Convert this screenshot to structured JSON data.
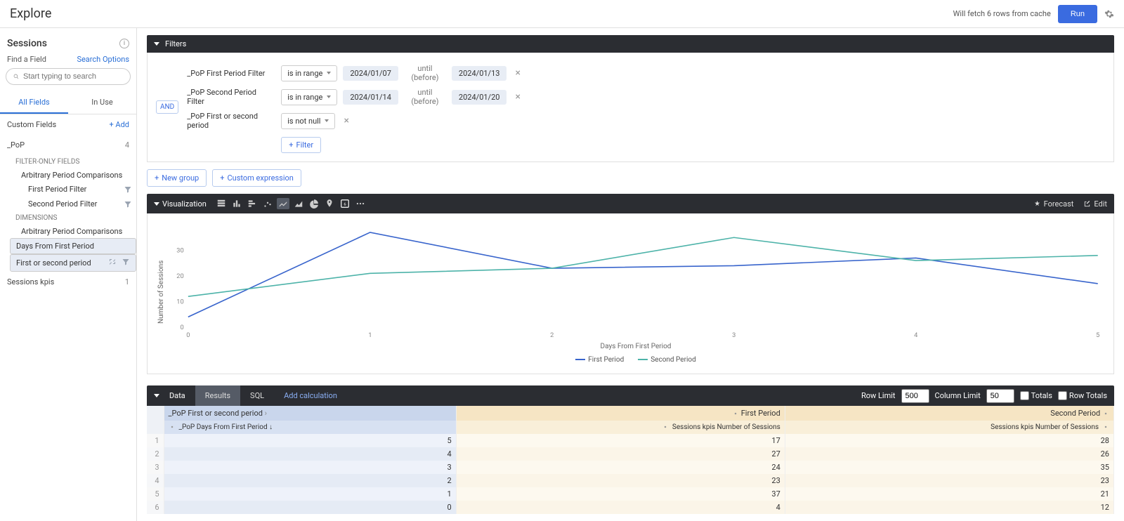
{
  "header": {
    "title": "Explore",
    "fetch_text": "Will fetch 6 rows from cache",
    "run_label": "Run"
  },
  "sidebar": {
    "section_title": "Sessions",
    "find_label": "Find a Field",
    "search_options": "Search Options",
    "search_placeholder": "Start typing to search",
    "tabs": {
      "all": "All Fields",
      "in_use": "In Use"
    },
    "custom_fields": {
      "label": "Custom Fields",
      "add": "+ Add"
    },
    "pop": {
      "label": "_PoP",
      "count": "4",
      "filter_only_label": "FILTER-ONLY FIELDS",
      "group1": "Arbitrary Period Comparisons",
      "f1": "First Period Filter",
      "f2": "Second Period Filter",
      "dimensions_label": "DIMENSIONS",
      "group2": "Arbitrary Period Comparisons",
      "d1": "Days From First Period",
      "d2": "First or second period"
    },
    "kpis": {
      "label": "Sessions kpis",
      "count": "1"
    }
  },
  "filters": {
    "title": "Filters",
    "and": "AND",
    "rows": [
      {
        "label": "_PoP First Period Filter",
        "op": "is in range",
        "v1": "2024/01/07",
        "mid": "until (before)",
        "v2": "2024/01/13"
      },
      {
        "label": "_PoP Second Period Filter",
        "op": "is in range",
        "v1": "2024/01/14",
        "mid": "until (before)",
        "v2": "2024/01/20"
      },
      {
        "label": "_PoP First or second period",
        "op": "is not null"
      }
    ],
    "add_filter": "Filter",
    "new_group": "New group",
    "custom_expr": "Custom expression"
  },
  "viz": {
    "title": "Visualization",
    "forecast": "Forecast",
    "edit": "Edit"
  },
  "data_bar": {
    "label": "Data",
    "tabs": {
      "results": "Results",
      "sql": "SQL",
      "calc": "Add calculation"
    },
    "row_limit_label": "Row Limit",
    "row_limit_value": "500",
    "col_limit_label": "Column Limit",
    "col_limit_value": "50",
    "totals": "Totals",
    "row_totals": "Row Totals"
  },
  "table": {
    "head_dim": "_PoP First or second period",
    "head_m1": "First Period",
    "head_m2": "Second Period",
    "sub_dim": "_PoP Days From First Period",
    "sub_m": "Sessions kpis Number of Sessions",
    "rows": [
      {
        "i": "1",
        "d": "5",
        "a": "17",
        "b": "28"
      },
      {
        "i": "2",
        "d": "4",
        "a": "27",
        "b": "26"
      },
      {
        "i": "3",
        "d": "3",
        "a": "24",
        "b": "35"
      },
      {
        "i": "4",
        "d": "2",
        "a": "23",
        "b": "23"
      },
      {
        "i": "5",
        "d": "1",
        "a": "37",
        "b": "21"
      },
      {
        "i": "6",
        "d": "0",
        "a": "4",
        "b": "12"
      }
    ]
  },
  "chart_data": {
    "type": "line",
    "title": "",
    "xlabel": "Days From First Period",
    "ylabel": "Number of Sessions",
    "x": [
      0,
      1,
      2,
      3,
      4,
      5
    ],
    "ylim": [
      0,
      40
    ],
    "yticks": [
      0,
      10,
      20,
      30
    ],
    "series": [
      {
        "name": "First Period",
        "color": "#3864cc",
        "values": [
          4,
          37,
          23,
          24,
          27,
          17
        ]
      },
      {
        "name": "Second Period",
        "color": "#4db3a9",
        "values": [
          12,
          21,
          23,
          35,
          26,
          28
        ]
      }
    ]
  }
}
